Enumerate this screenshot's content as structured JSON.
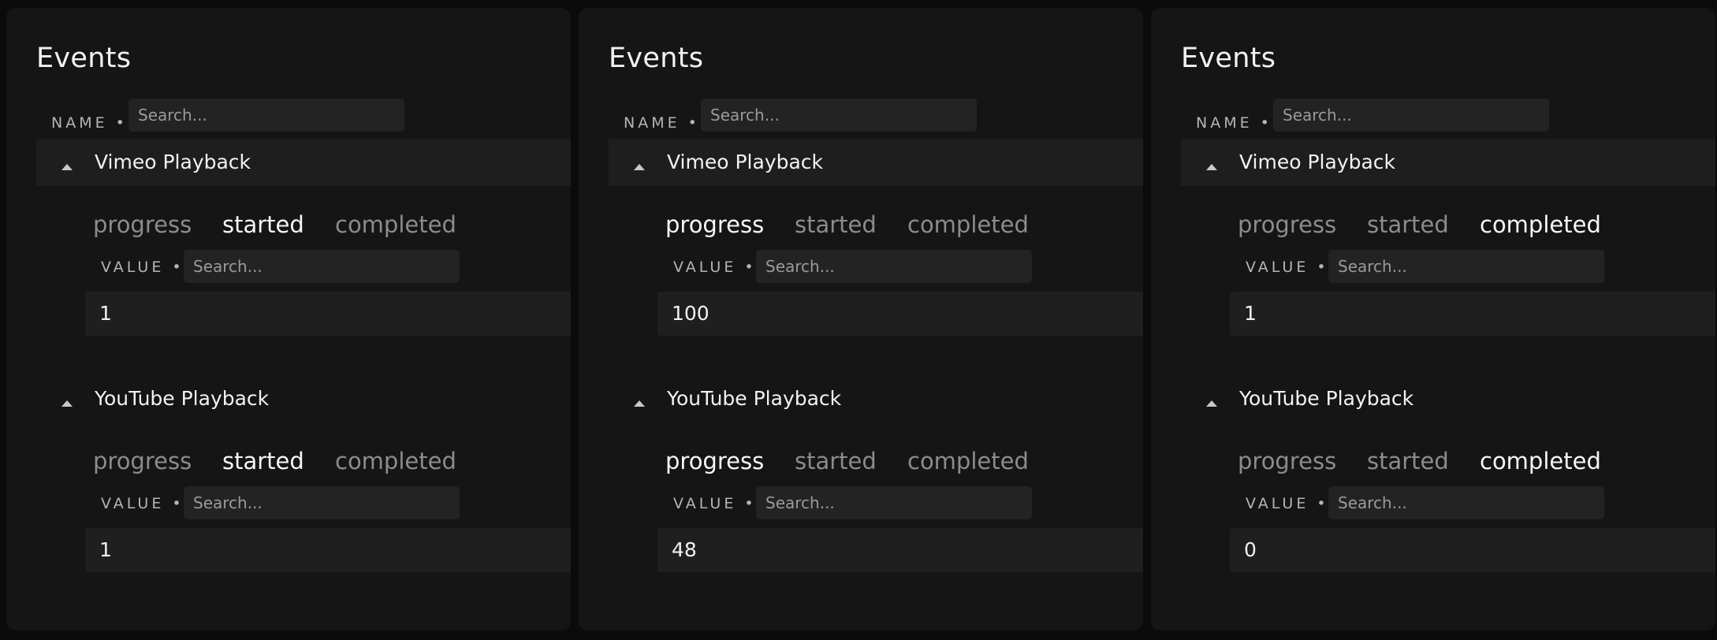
{
  "panels": [
    {
      "title": "Events",
      "name_filter": {
        "label": "NAME •",
        "placeholder": "Search..."
      },
      "groups": [
        {
          "name": "Vimeo Playback",
          "tabs": [
            "progress",
            "started",
            "completed"
          ],
          "active_tab": "started",
          "value_filter": {
            "label": "VALUE •",
            "placeholder": "Search..."
          },
          "value": "1"
        },
        {
          "name": "YouTube Playback",
          "tabs": [
            "progress",
            "started",
            "completed"
          ],
          "active_tab": "started",
          "value_filter": {
            "label": "VALUE •",
            "placeholder": "Search..."
          },
          "value": "1"
        }
      ]
    },
    {
      "title": "Events",
      "name_filter": {
        "label": "NAME •",
        "placeholder": "Search..."
      },
      "groups": [
        {
          "name": "Vimeo Playback",
          "tabs": [
            "progress",
            "started",
            "completed"
          ],
          "active_tab": "progress",
          "value_filter": {
            "label": "VALUE •",
            "placeholder": "Search..."
          },
          "value": "100"
        },
        {
          "name": "YouTube Playback",
          "tabs": [
            "progress",
            "started",
            "completed"
          ],
          "active_tab": "progress",
          "value_filter": {
            "label": "VALUE •",
            "placeholder": "Search..."
          },
          "value": "48"
        }
      ]
    },
    {
      "title": "Events",
      "name_filter": {
        "label": "NAME •",
        "placeholder": "Search..."
      },
      "groups": [
        {
          "name": "Vimeo Playback",
          "tabs": [
            "progress",
            "started",
            "completed"
          ],
          "active_tab": "completed",
          "value_filter": {
            "label": "VALUE •",
            "placeholder": "Search..."
          },
          "value": "1"
        },
        {
          "name": "YouTube Playback",
          "tabs": [
            "progress",
            "started",
            "completed"
          ],
          "active_tab": "completed",
          "value_filter": {
            "label": "VALUE •",
            "placeholder": "Search..."
          },
          "value": "0"
        }
      ]
    }
  ],
  "colors": {
    "page_background": "#0b0b0b",
    "panel_background": "#151515",
    "input_background": "#232323",
    "active_tab": "#f7f7f7",
    "inactive_tab": "#8c8c8c"
  },
  "icons": {
    "group_toggle": "caret-up-icon"
  }
}
